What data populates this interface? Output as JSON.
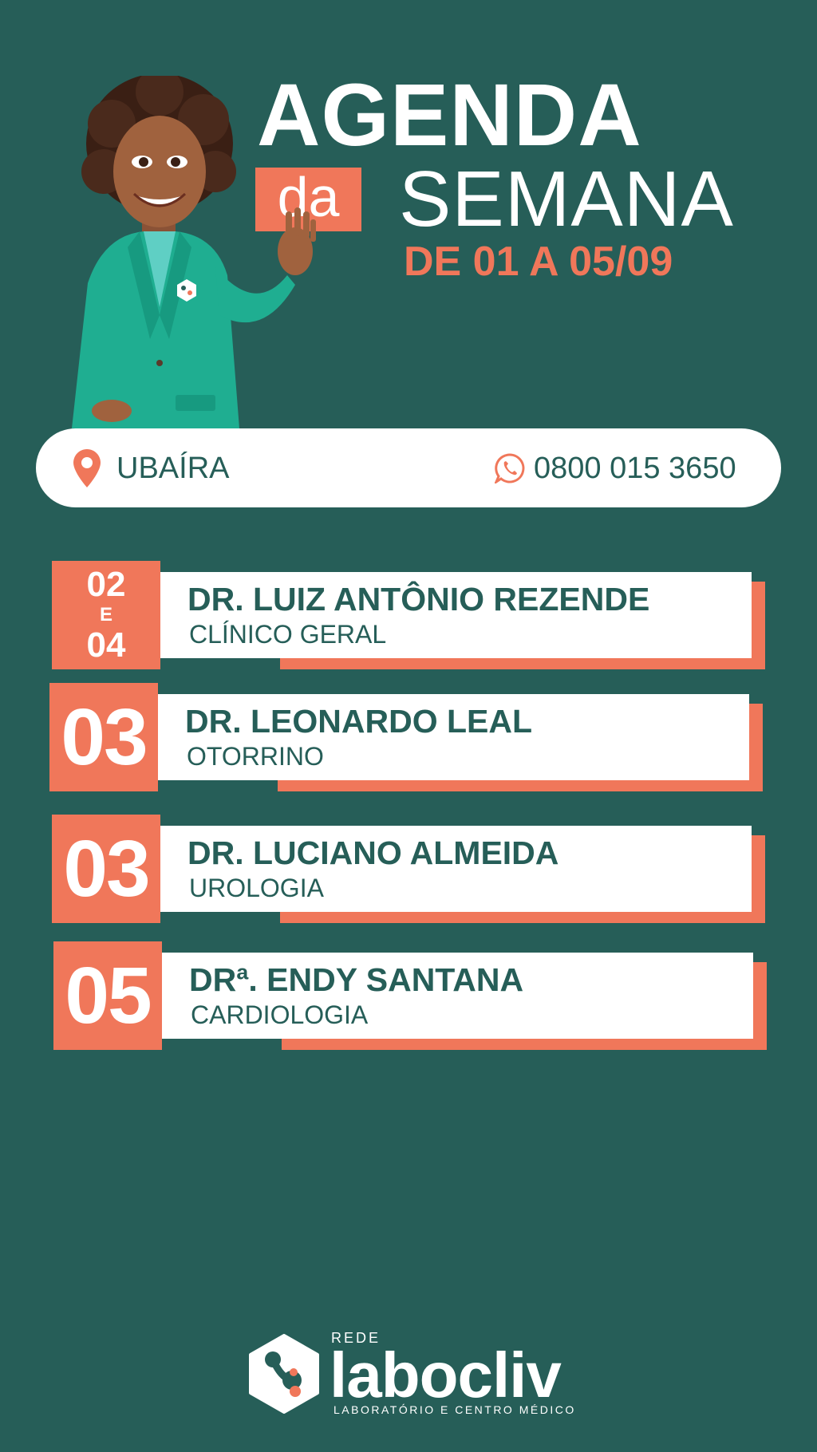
{
  "header": {
    "title_line1": "AGENDA",
    "title_da": "da",
    "title_line2": "SEMANA",
    "date_range": "DE 01 A 05/09"
  },
  "info": {
    "location": "UBAÍRA",
    "location_icon": "map-pin-icon",
    "phone": "0800 015 3650",
    "phone_icon": "whatsapp-icon"
  },
  "schedule": [
    {
      "day_top": "02",
      "day_join": "E",
      "day_bottom": "04",
      "doctor": "DR. LUIZ ANTÔNIO REZENDE",
      "specialty": "CLÍNICO GERAL"
    },
    {
      "day": "03",
      "doctor": "DR. LEONARDO LEAL",
      "specialty": "OTORRINO"
    },
    {
      "day": "03",
      "doctor": "DR. LUCIANO ALMEIDA",
      "specialty": "UROLOGIA"
    },
    {
      "day": "05",
      "doctor": "DRª. ENDY SANTANA",
      "specialty": "CARDIOLOGIA"
    }
  ],
  "logo": {
    "rede": "REDE",
    "name": "labocliv",
    "tagline": "LABORATÓRIO E CENTRO MÉDICO"
  },
  "colors": {
    "background": "#265e58",
    "accent": "#f0775a",
    "white": "#ffffff"
  }
}
